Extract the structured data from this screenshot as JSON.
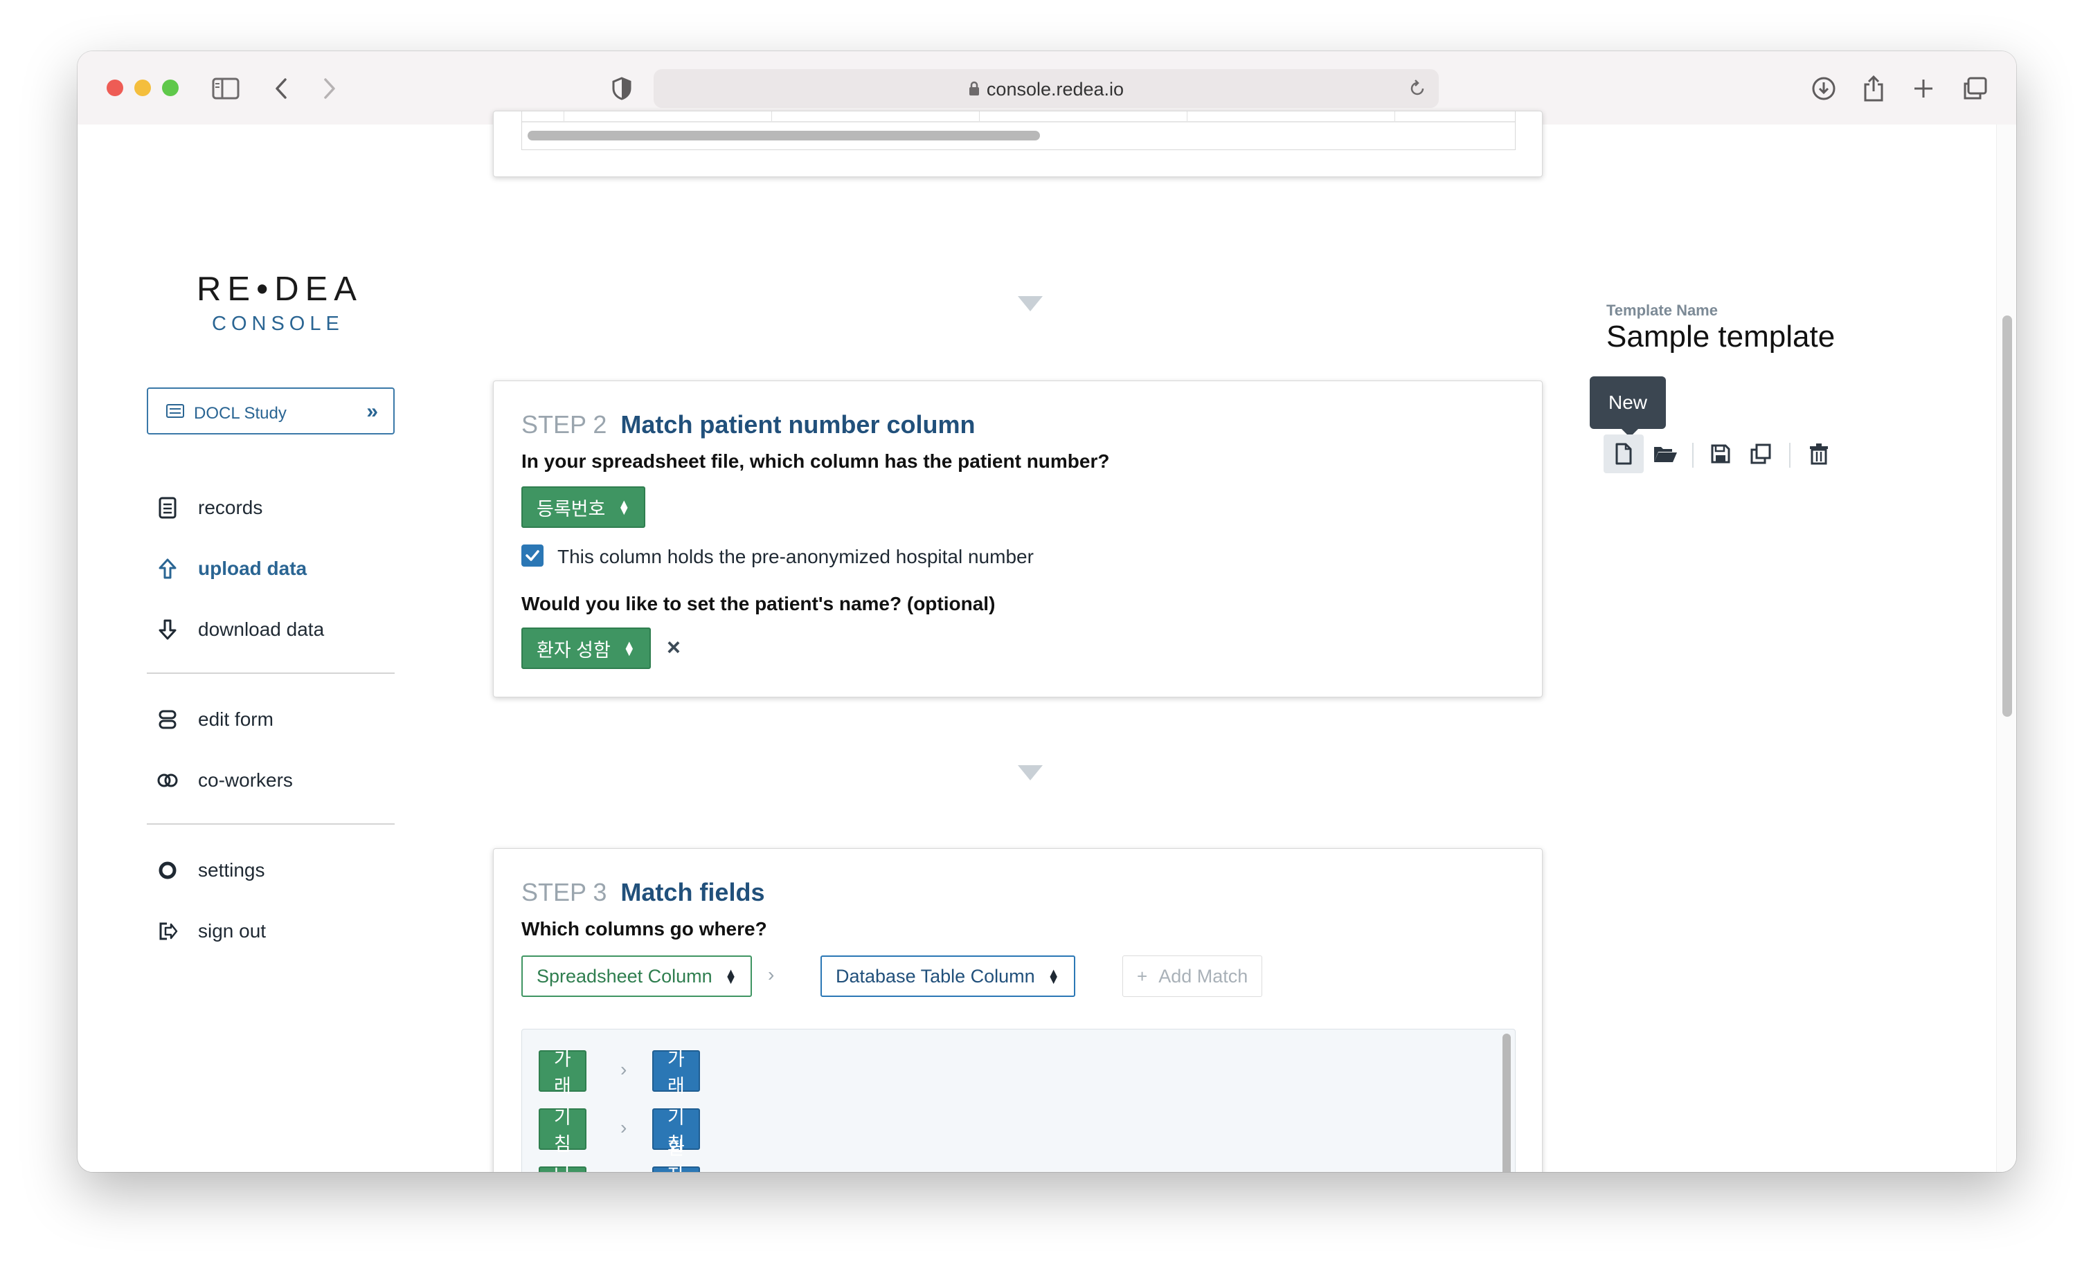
{
  "browser": {
    "url": "console.redea.io"
  },
  "sidebar": {
    "logo_main": "RE•DEA",
    "logo_sub": "CONSOLE",
    "study_label": "DOCL Study",
    "items": [
      {
        "label": "records",
        "icon": "document-list-icon"
      },
      {
        "label": "upload data",
        "icon": "upload-arrow-icon"
      },
      {
        "label": "download data",
        "icon": "download-arrow-icon"
      },
      {
        "label": "edit form",
        "icon": "stack-icon"
      },
      {
        "label": "co-workers",
        "icon": "linked-circles-icon"
      },
      {
        "label": "settings",
        "icon": "ring-icon"
      },
      {
        "label": "sign out",
        "icon": "sign-out-icon"
      }
    ],
    "active_item": "upload data"
  },
  "step2": {
    "step_number": "STEP 2",
    "title": "Match patient number column",
    "question1": "In your spreadsheet file, which column has the patient number?",
    "patient_number_select": "등록번호",
    "checkbox_label": "This column holds the pre-anonymized hospital number",
    "checkbox_checked": true,
    "question2": "Would you like to set the patient's name? (optional)",
    "patient_name_select": "환자 성함",
    "clear_symbol": "×"
  },
  "step3": {
    "step_number": "STEP 3",
    "title": "Match fields",
    "question": "Which columns go where?",
    "spreadsheet_select": "Spreadsheet Column",
    "database_select": "Database Table Column",
    "add_match": "Add Match",
    "matches": [
      {
        "from": "가래",
        "to": "가래"
      },
      {
        "from": "기침",
        "to": "기침"
      },
      {
        "from": "나이",
        "to": "환자 나이"
      }
    ]
  },
  "template": {
    "label": "Template Name",
    "name": "Sample template",
    "tooltip": "New",
    "tools": [
      "new-file-icon",
      "open-folder-icon",
      "save-icon",
      "duplicate-icon",
      "trash-icon"
    ]
  },
  "colors": {
    "green": "#3f9562",
    "blue": "#2b77b5",
    "title_blue": "#21507b",
    "tooltip_bg": "#3b4651"
  }
}
